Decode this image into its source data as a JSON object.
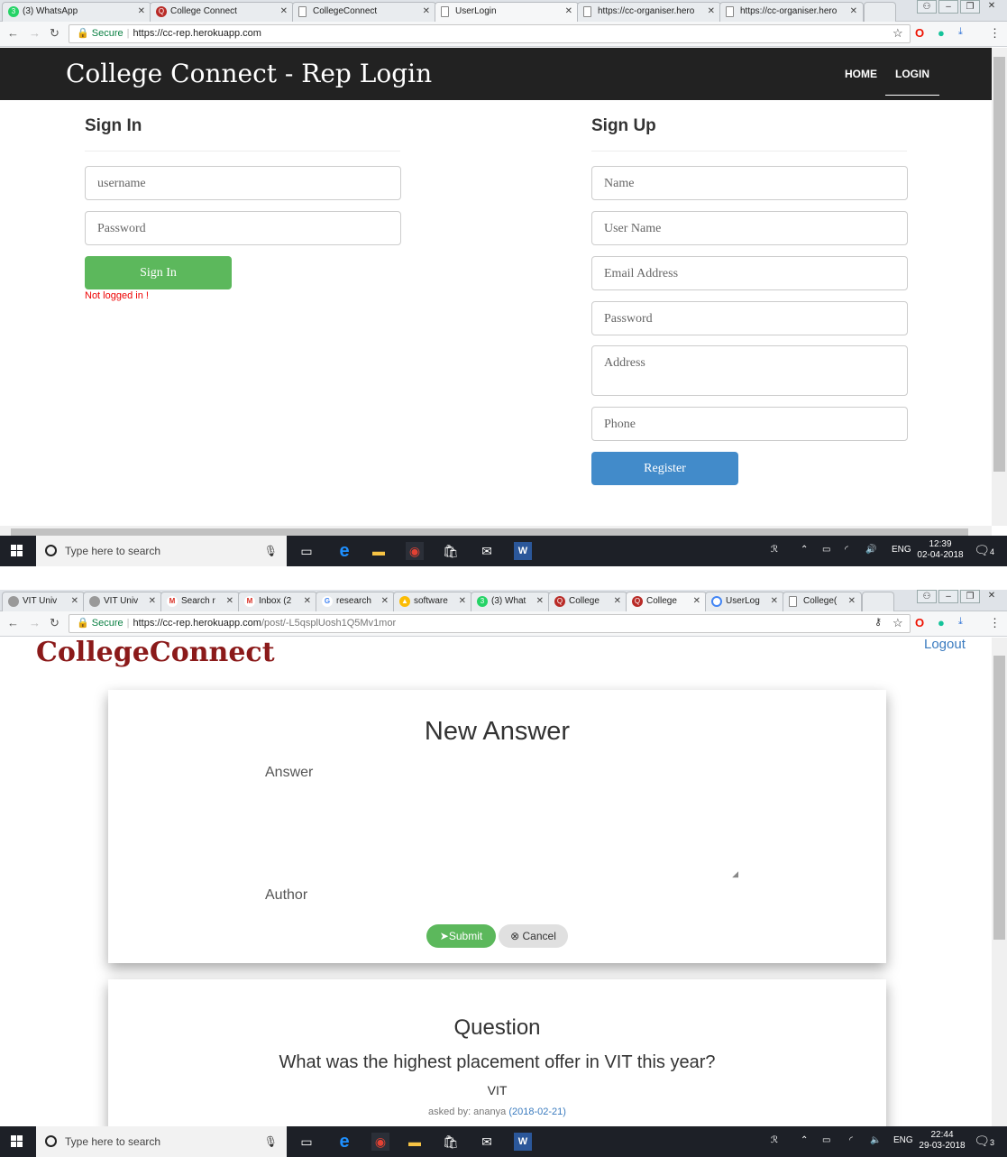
{
  "screenshot1": {
    "tabs": [
      {
        "title": "(3) WhatsApp",
        "icon": "whatsapp-icon",
        "color": "#25d366"
      },
      {
        "title": "College Connect",
        "icon": "quora-icon",
        "color": "#b92b27"
      },
      {
        "title": "CollegeConnect",
        "icon": "page-icon",
        "color": "#888888"
      },
      {
        "title": "UserLogin",
        "icon": "page-icon",
        "color": "#888888"
      },
      {
        "title": "https://cc-organiser.hero",
        "icon": "page-icon",
        "color": "#888888"
      },
      {
        "title": "https://cc-organiser.hero",
        "icon": "page-icon",
        "color": "#888888"
      }
    ],
    "address": {
      "secure_label": "Secure",
      "url": "https://cc-rep.herokuapp.com",
      "path": ""
    },
    "page": {
      "brand": "College Connect - Rep Login",
      "nav": {
        "home": "HOME",
        "login": "LOGIN"
      },
      "sign_in": {
        "heading": "Sign In",
        "username_placeholder": "username",
        "password_placeholder": "Password",
        "button": "Sign In",
        "status": "Not logged in !"
      },
      "sign_up": {
        "heading": "Sign Up",
        "name_placeholder": "Name",
        "username_placeholder": "User Name",
        "email_placeholder": "Email Address",
        "password_placeholder": "Password",
        "address_placeholder": "Address",
        "phone_placeholder": "Phone",
        "button": "Register"
      }
    },
    "taskbar": {
      "search": "Type here to search",
      "lang": "ENG",
      "time": "12:39",
      "date": "02-04-2018",
      "notifications": "4"
    }
  },
  "screenshot2": {
    "tabs": [
      {
        "title": "VIT Univ",
        "icon": "page-icon"
      },
      {
        "title": "VIT Univ",
        "icon": "page-icon"
      },
      {
        "title": "Search r",
        "icon": "gmail-icon"
      },
      {
        "title": "Inbox (2",
        "icon": "gmail-icon"
      },
      {
        "title": "research",
        "icon": "google-icon"
      },
      {
        "title": "software",
        "icon": "drive-icon"
      },
      {
        "title": "(3) What",
        "icon": "whatsapp-icon"
      },
      {
        "title": "College",
        "icon": "quora-icon"
      },
      {
        "title": "College",
        "icon": "quora-icon"
      },
      {
        "title": "UserLog",
        "icon": "loading-icon"
      },
      {
        "title": "College(",
        "icon": "page-icon"
      }
    ],
    "address": {
      "secure_label": "Secure",
      "url": "https://cc-rep.herokuapp.com",
      "path": "/post/-L5qsplUosh1Q5Mv1mor"
    },
    "page": {
      "logo": "CollegeConnect",
      "logout": "Logout",
      "form": {
        "title": "New Answer",
        "answer_label": "Answer",
        "author_label": "Author",
        "submit": "Submit",
        "cancel": "Cancel"
      },
      "question": {
        "heading": "Question",
        "text": "What was the highest placement offer in VIT this year?",
        "college": "VIT",
        "asked_by_prefix": "asked by: ananya",
        "date": "(2018-02-21)"
      }
    },
    "taskbar": {
      "search": "Type here to search",
      "lang": "ENG",
      "time": "22:44",
      "date": "29-03-2018",
      "notifications": "3"
    }
  },
  "colors": {
    "success": "#5cb85c",
    "primary": "#428bca",
    "error": "#ee0000",
    "brand_red": "#8b1a1a",
    "link": "#3a7bbf"
  }
}
